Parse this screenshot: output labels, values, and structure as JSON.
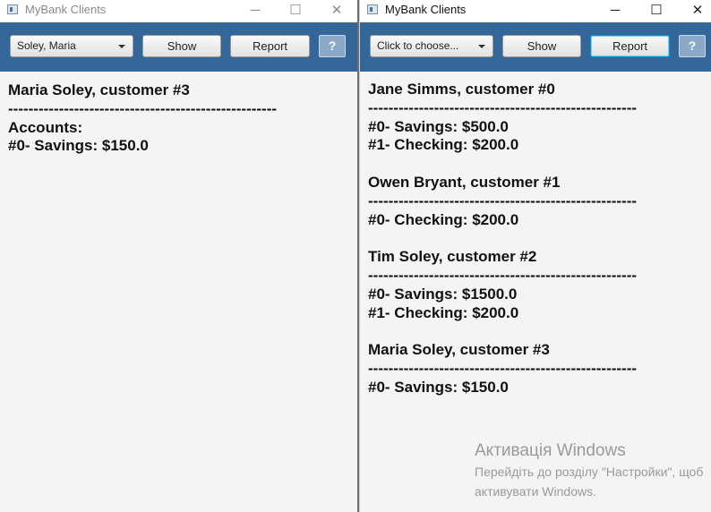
{
  "left_window": {
    "title": "MyBank Clients",
    "controls": {
      "minimize": "─",
      "maximize": "☐",
      "close": "✕"
    },
    "toolbar": {
      "combo_value": "Soley, Maria",
      "show_label": "Show",
      "report_label": "Report",
      "help_label": "?"
    },
    "content_lines": [
      "Maria Soley, customer #3",
      "-----------------------------------------------------",
      "Accounts:",
      "#0- Savings: $150.0"
    ]
  },
  "right_window": {
    "title": "MyBank Clients",
    "controls": {
      "minimize": "─",
      "maximize": "☐",
      "close": "✕"
    },
    "toolbar": {
      "combo_value": "Click to choose...",
      "show_label": "Show",
      "report_label": "Report",
      "help_label": "?"
    },
    "content_lines": [
      "Jane Simms, customer #0",
      "-----------------------------------------------------",
      "#0- Savings: $500.0",
      "#1- Checking: $200.0",
      "",
      "Owen Bryant, customer #1",
      "-----------------------------------------------------",
      "#0- Checking: $200.0",
      "",
      "Tim Soley, customer #2",
      "-----------------------------------------------------",
      "#0- Savings: $1500.0",
      "#1- Checking: $200.0",
      "",
      "Maria Soley, customer #3",
      "-----------------------------------------------------",
      "#0- Savings: $150.0"
    ]
  },
  "watermark": {
    "title": "Активація Windows",
    "line1": "Перейдіть до розділу \"Настройки\", щоб",
    "line2": "активувати Windows."
  },
  "colors": {
    "toolbar": "#336699",
    "help_button": "#8aa8c7",
    "focus_ring": "#0096c9"
  }
}
